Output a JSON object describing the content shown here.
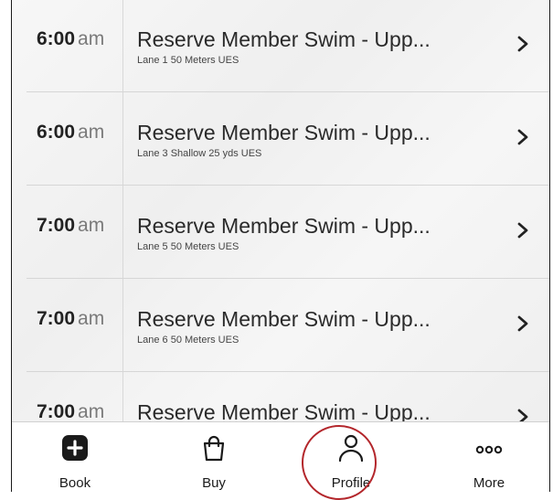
{
  "sessions": [
    {
      "hour": "6:00",
      "ampm": "am",
      "title": "Reserve Member Swim - Upp...",
      "subtitle": "Lane 1 50 Meters UES"
    },
    {
      "hour": "6:00",
      "ampm": "am",
      "title": "Reserve Member Swim - Upp...",
      "subtitle": "Lane 3 Shallow 25 yds UES"
    },
    {
      "hour": "7:00",
      "ampm": "am",
      "title": "Reserve Member Swim - Upp...",
      "subtitle": "Lane 5 50 Meters UES"
    },
    {
      "hour": "7:00",
      "ampm": "am",
      "title": "Reserve Member Swim - Upp...",
      "subtitle": "Lane 6 50 Meters UES"
    },
    {
      "hour": "7:00",
      "ampm": "am",
      "title": "Reserve Member Swim - Upp...",
      "subtitle": ""
    }
  ],
  "tabbar": {
    "tabs": [
      {
        "label": "Book",
        "icon": "plus-square-icon"
      },
      {
        "label": "Buy",
        "icon": "shopping-bag-icon"
      },
      {
        "label": "Profile",
        "icon": "person-icon"
      },
      {
        "label": "More",
        "icon": "more-dots-icon"
      }
    ]
  },
  "colors": {
    "highlight_ring": "#b3262b",
    "text": "#222222"
  }
}
